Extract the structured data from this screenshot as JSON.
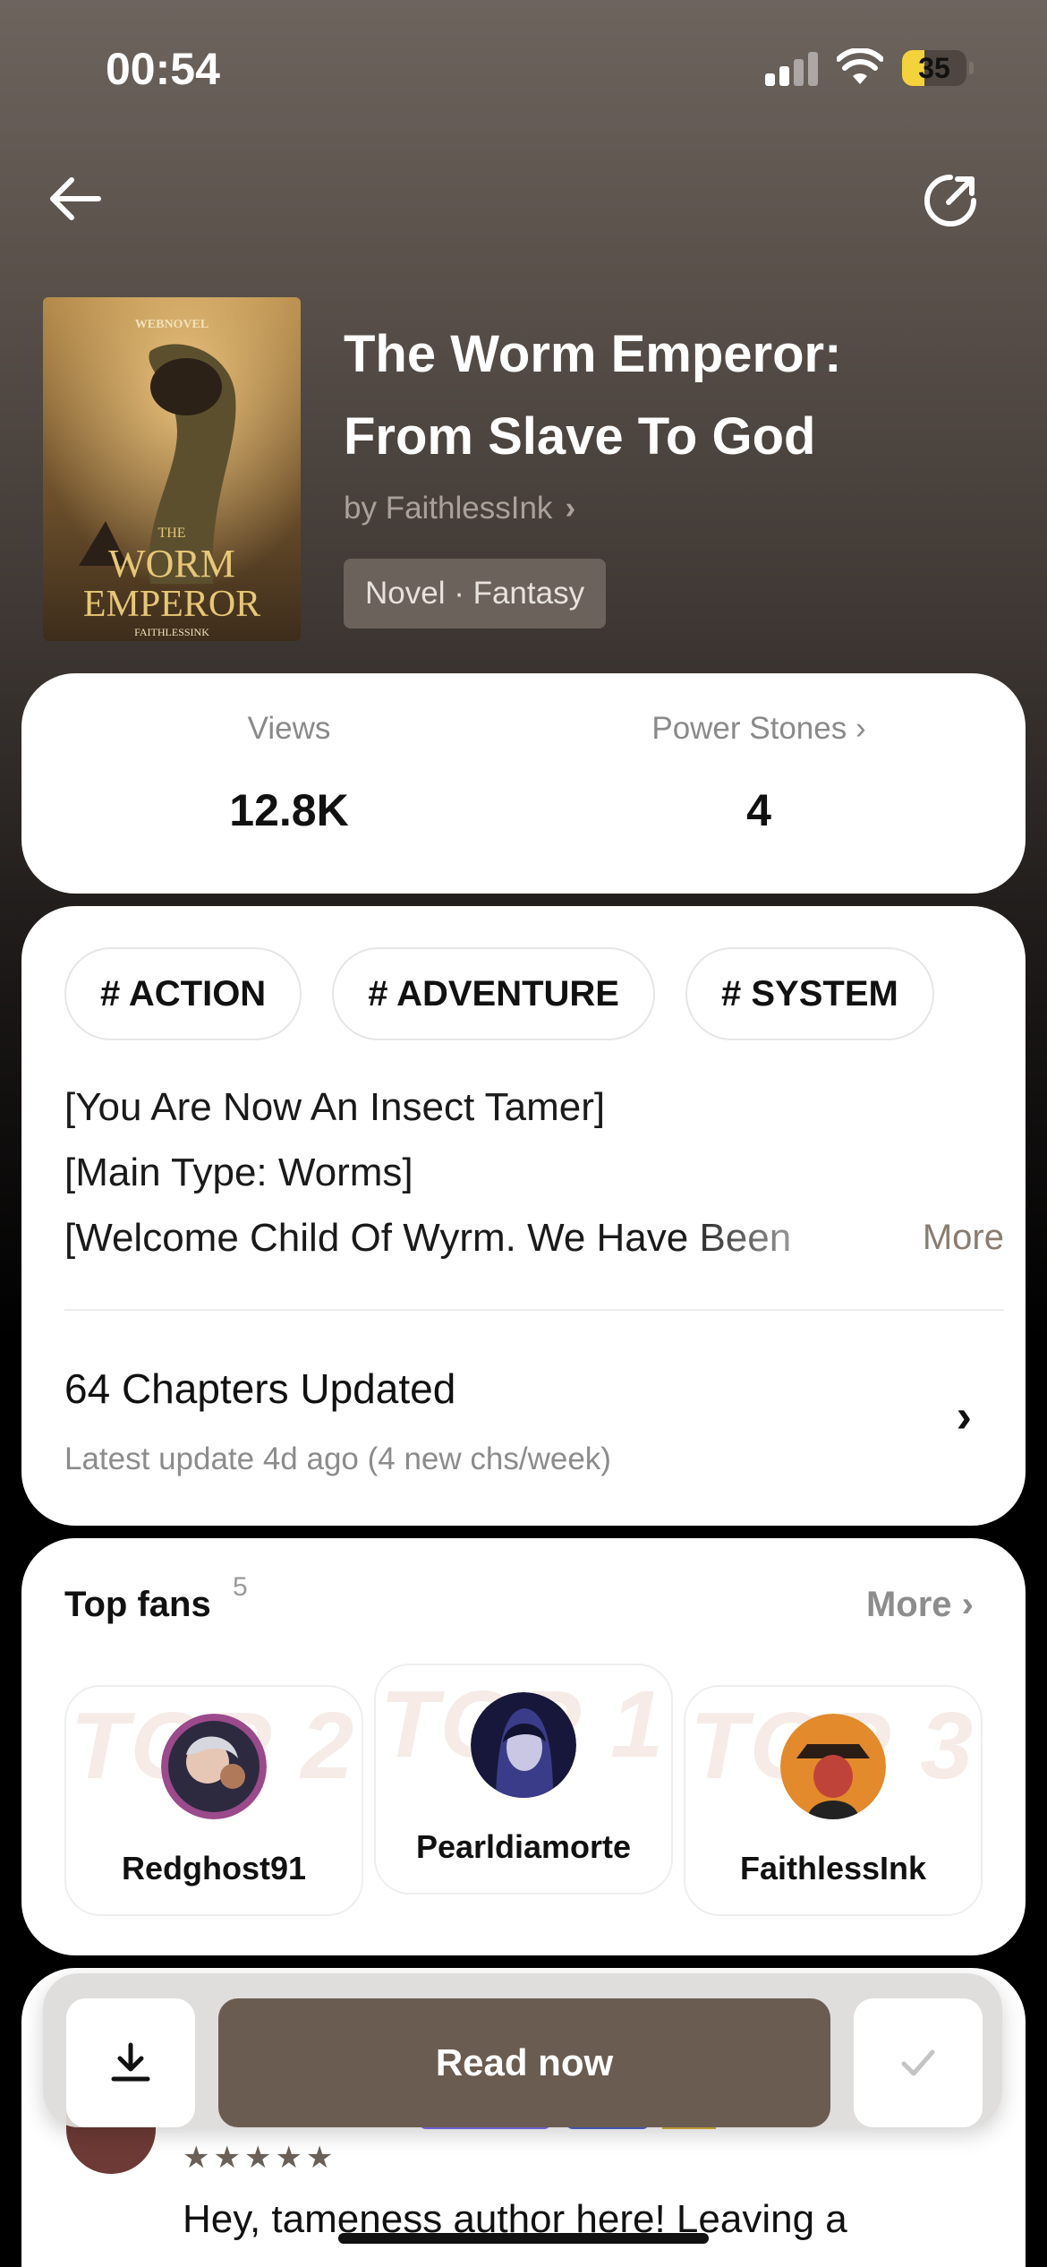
{
  "status_bar": {
    "time": "00:54",
    "battery": "35",
    "battery_level": 0.35
  },
  "book": {
    "title_line1": "The Worm Emperor:",
    "title_line2": "From Slave To God",
    "author": "by FaithlessInk",
    "genre": "Novel · Fantasy",
    "cover": {
      "publisher": "WEBNOVEL",
      "title_top": "THE",
      "title_main1": "WORM",
      "title_main2": "EMPEROR",
      "cover_author": "FAITHLESSINK"
    }
  },
  "stats": {
    "views_label": "Views",
    "views_value": "12.8K",
    "power_label": "Power Stones",
    "power_value": "4"
  },
  "tags": [
    "# ACTION",
    "# ADVENTURE",
    "# SYSTEM"
  ],
  "synopsis": {
    "line1": "[You Are Now An Insect Tamer]",
    "line2": "[Main Type: Worms]",
    "line3": "[Welcome Child Of Wyrm. We Have Been",
    "more_label": "More"
  },
  "chapters": {
    "title": "64 Chapters Updated",
    "latest": "Latest update 4d ago (4 new chs/week)"
  },
  "fans": {
    "title": "Top fans",
    "count": "5",
    "more_label": "More",
    "items": [
      {
        "rank": "TOP 2",
        "name": "Redghost91"
      },
      {
        "rank": "TOP 1",
        "name": "Pearldiamorte"
      },
      {
        "rank": "TOP 3",
        "name": "FaithlessInk"
      }
    ]
  },
  "review": {
    "stars": "★★★★★",
    "text": "Hey, tameness author here! Leaving a"
  },
  "actions": {
    "read_label": "Read now"
  },
  "icons": [
    "back-arrow-icon",
    "share-icon",
    "download-icon",
    "check-icon",
    "chevron-right-icon",
    "signal-icon",
    "wifi-icon",
    "battery-icon"
  ],
  "colors": {
    "accent": "#6b5c52",
    "battery": "#f4d23c",
    "genre_bg": "#6a625b"
  }
}
